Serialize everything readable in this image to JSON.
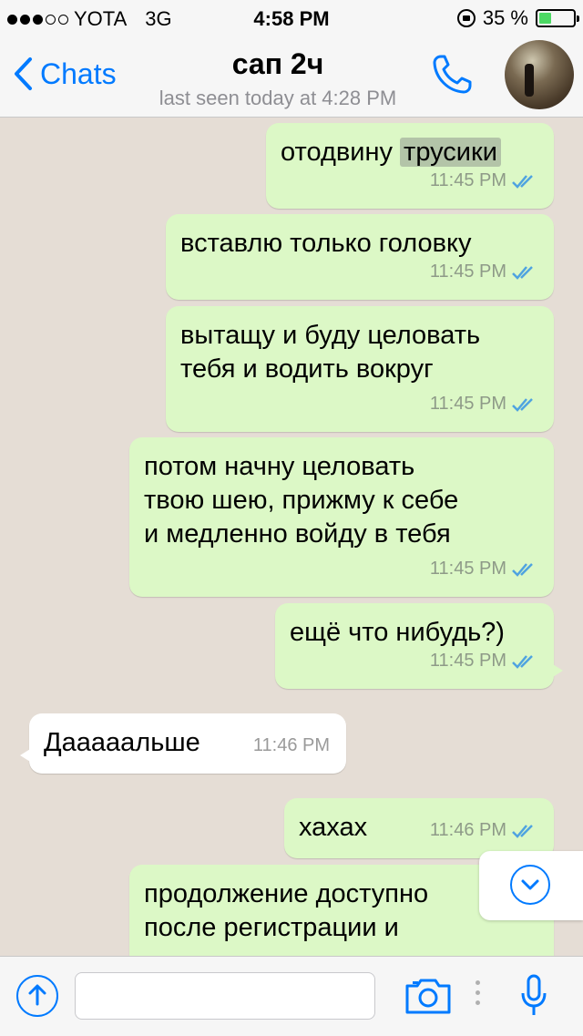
{
  "status_bar": {
    "carrier": "YOTA",
    "network": "3G",
    "time": "4:58 PM",
    "battery_percent": "35 %",
    "battery_level": 0.35,
    "signal_bars_filled": 3,
    "signal_bars_total": 5
  },
  "nav": {
    "back_label": "Chats",
    "title": "сап 2ч",
    "subtitle": "last seen today at 4:28 PM"
  },
  "messages": [
    {
      "dir": "out",
      "text_before": "отодвину ",
      "text_highlight": "трусики",
      "time": "11:45 PM"
    },
    {
      "dir": "out",
      "text": "вставлю только головку",
      "time": "11:45 PM"
    },
    {
      "dir": "out",
      "text": "вытащу и буду целовать\nтебя и водить вокруг",
      "time": "11:45 PM"
    },
    {
      "dir": "out",
      "text": "потом начну целовать\nтвою шею, прижму к себе\nи медленно войду в тебя",
      "time": "11:45 PM"
    },
    {
      "dir": "out",
      "text": "ещё что нибудь?)",
      "time": "11:45 PM"
    },
    {
      "dir": "in",
      "text": "Дааааальше",
      "time": "11:46 PM"
    },
    {
      "dir": "out",
      "text": "хахах",
      "time": "11:46 PM"
    },
    {
      "dir": "out",
      "text": "продолжение доступно\nпосле регистрации и",
      "time": ""
    }
  ],
  "input": {
    "value": "",
    "placeholder": ""
  },
  "colors": {
    "accent": "#007aff",
    "outgoing_bubble": "#dcf8c6",
    "incoming_bubble": "#ffffff",
    "chat_background": "#e5ddd5",
    "read_ticks": "#4fa3e0"
  }
}
